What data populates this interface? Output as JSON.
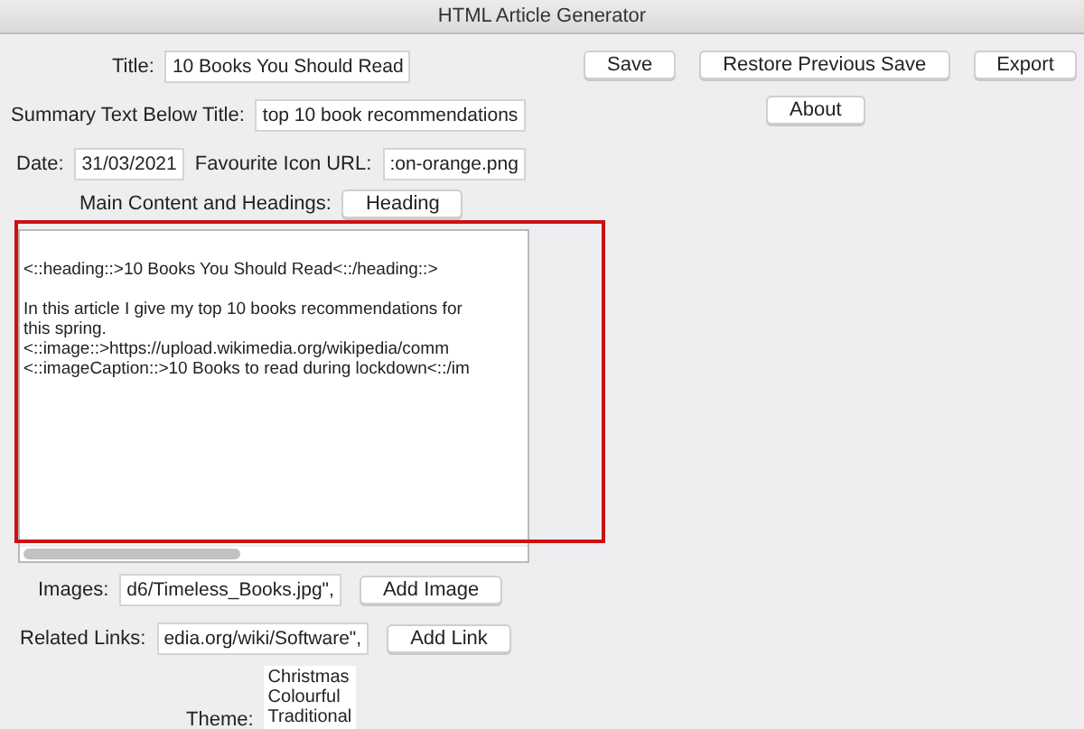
{
  "window": {
    "title": "HTML Article Generator"
  },
  "action_buttons": [
    "Save",
    "Restore Previous Save",
    "Export"
  ],
  "about_button": "About",
  "title_field": {
    "label": "Title:",
    "value": "10 Books You Should Read"
  },
  "summary_field": {
    "label": "Summary Text Below Title:",
    "value": "top 10 book recommendations"
  },
  "date_field": {
    "label": "Date:",
    "value": "31/03/2021"
  },
  "favicon_field": {
    "label": "Favourite Icon URL:",
    "value": ":on-orange.png"
  },
  "main_content": {
    "label": "Main Content and Headings:",
    "button": "Heading",
    "paragraphs": [
      [
        "<::heading::>10 Books You Should Read<::/heading::>"
      ],
      [
        "In this article I give my top 10 books recommendations for",
        "this spring.",
        "<::image::>https://upload.wikimedia.org/wikipedia/comm",
        "<::imageCaption::>10 Books to read during lockdown<::/im"
      ]
    ]
  },
  "images_field": {
    "label": "Images:",
    "value": "d6/Timeless_Books.jpg\",",
    "button": "Add Image"
  },
  "links_field": {
    "label": "Related Links:",
    "value": "edia.org/wiki/Software\",",
    "button": "Add Link"
  },
  "theme": {
    "label": "Theme:",
    "options": [
      "Christmas",
      "Colourful",
      "Traditional"
    ]
  }
}
